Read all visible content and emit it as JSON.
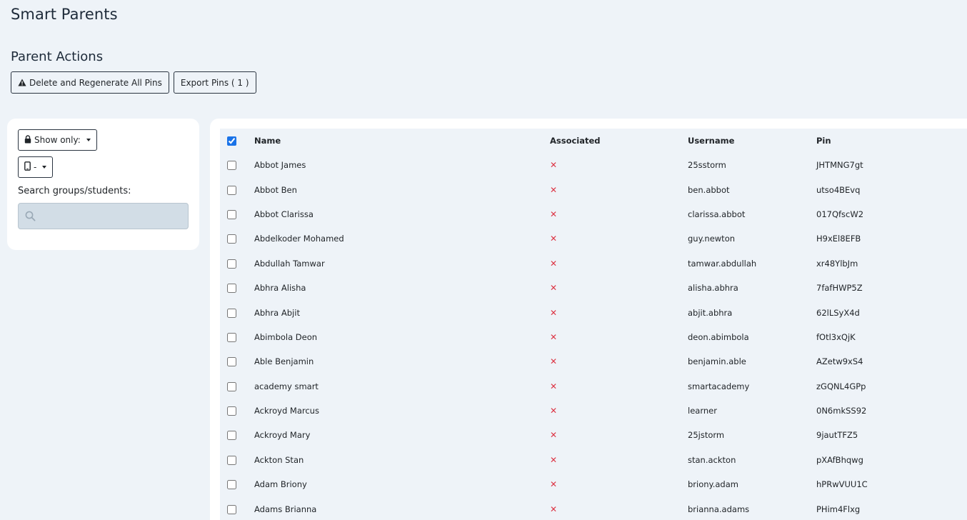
{
  "app_title": "Smart Parents",
  "section_title": "Parent Actions",
  "actions": {
    "delete_regen_label": "Delete and Regenerate All Pins",
    "export_label": "Export Pins ( 1 )"
  },
  "filters": {
    "show_only_label": "Show only:",
    "device_label": "-",
    "search_label": "Search groups/students:",
    "search_value": ""
  },
  "table": {
    "headers": [
      "Name",
      "Associated",
      "Username",
      "Pin"
    ],
    "header_checked": true,
    "rows": [
      {
        "name": "Abbot James",
        "associated": "✕",
        "username": "25sstorm",
        "pin": "JHTMNG7gt"
      },
      {
        "name": "Abbot Ben",
        "associated": "✕",
        "username": "ben.abbot",
        "pin": "utso4BEvq"
      },
      {
        "name": "Abbot Clarissa",
        "associated": "✕",
        "username": "clarissa.abbot",
        "pin": "017QfscW2"
      },
      {
        "name": "Abdelkoder Mohamed",
        "associated": "✕",
        "username": "guy.newton",
        "pin": "H9xEl8EFB"
      },
      {
        "name": "Abdullah Tamwar",
        "associated": "✕",
        "username": "tamwar.abdullah",
        "pin": "xr48YlbJm"
      },
      {
        "name": "Abhra Alisha",
        "associated": "✕",
        "username": "alisha.abhra",
        "pin": "7fafHWP5Z"
      },
      {
        "name": "Abhra Abjit",
        "associated": "✕",
        "username": "abjit.abhra",
        "pin": "62lLSyX4d"
      },
      {
        "name": "Abimbola Deon",
        "associated": "✕",
        "username": "deon.abimbola",
        "pin": "fOtl3xQjK"
      },
      {
        "name": "Able Benjamin",
        "associated": "✕",
        "username": "benjamin.able",
        "pin": "AZetw9xS4"
      },
      {
        "name": "academy smart",
        "associated": "✕",
        "username": "smartacademy",
        "pin": "zGQNL4GPp"
      },
      {
        "name": "Ackroyd Marcus",
        "associated": "✕",
        "username": "learner",
        "pin": "0N6mkSS92"
      },
      {
        "name": "Ackroyd Mary",
        "associated": "✕",
        "username": "25jstorm",
        "pin": "9jautTFZ5"
      },
      {
        "name": "Ackton Stan",
        "associated": "✕",
        "username": "stan.ackton",
        "pin": "pXAfBhqwg"
      },
      {
        "name": "Adam Briony",
        "associated": "✕",
        "username": "briony.adam",
        "pin": "hPRwVUU1C"
      },
      {
        "name": "Adams Brianna",
        "associated": "✕",
        "username": "brianna.adams",
        "pin": "PHim4Flxg"
      }
    ]
  },
  "colors": {
    "background": "#eef3f8",
    "card": "#ffffff",
    "cross": "#dc3545",
    "checkbox_accent": "#1a73e8",
    "search_fill": "#d2dde6"
  },
  "icons": {
    "warning": "warning-triangle-icon",
    "lock": "lock-icon",
    "phone": "phone-icon",
    "search": "search-icon",
    "cross": "cross-icon"
  }
}
